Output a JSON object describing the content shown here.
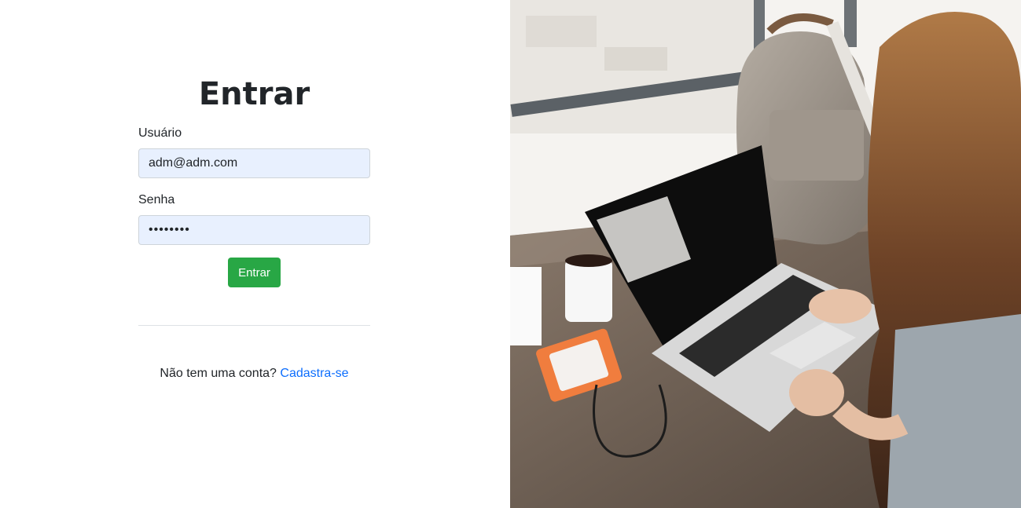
{
  "login": {
    "title": "Entrar",
    "username_label": "Usuário",
    "username_value": "adm@adm.com",
    "password_label": "Senha",
    "password_value": "••••••••",
    "submit_label": "Entrar",
    "signup_prompt": "Não tem uma conta?",
    "signup_link": "Cadastra-se"
  },
  "colors": {
    "primary_button": "#28a745",
    "link": "#0d6efd",
    "autofill_bg": "#e8f0fe"
  }
}
